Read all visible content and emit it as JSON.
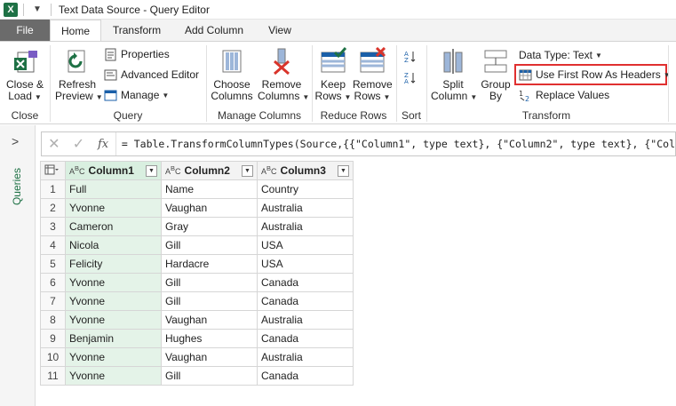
{
  "window": {
    "title": "Text Data Source - Query Editor",
    "app_logo": "X"
  },
  "tabs": [
    "File",
    "Home",
    "Transform",
    "Add Column",
    "View"
  ],
  "ribbon": {
    "close": {
      "btn": "Close &",
      "btn2": "Load",
      "group": "Close"
    },
    "query": {
      "refresh": "Refresh",
      "refresh2": "Preview",
      "properties": "Properties",
      "advanced_editor": "Advanced Editor",
      "manage": "Manage",
      "group": "Query"
    },
    "manage_columns": {
      "choose": "Choose",
      "choose2": "Columns",
      "remove": "Remove",
      "remove2": "Columns",
      "group": "Manage Columns"
    },
    "reduce_rows": {
      "keep": "Keep",
      "keep2": "Rows",
      "remove": "Remove",
      "remove2": "Rows",
      "group": "Reduce Rows"
    },
    "sort": {
      "group": "Sort"
    },
    "transform": {
      "split": "Split",
      "split2": "Column",
      "group_by": "Group",
      "group_by2": "By",
      "data_type": "Data Type: Text",
      "first_row": "Use First Row As Headers",
      "replace": "Replace Values",
      "group": "Transform"
    }
  },
  "side": {
    "label": "Queries"
  },
  "formula": {
    "text": "= Table.TransformColumnTypes(Source,{{\"Column1\", type text}, {\"Column2\", type text}, {\"Col"
  },
  "table": {
    "headers": [
      "Column1",
      "Column2",
      "Column3"
    ],
    "rows": [
      [
        "1",
        "Full",
        "Name",
        "Country"
      ],
      [
        "2",
        "Yvonne",
        "Vaughan",
        "Australia"
      ],
      [
        "3",
        "Cameron",
        "Gray",
        "Australia"
      ],
      [
        "4",
        "Nicola",
        "Gill",
        "USA"
      ],
      [
        "5",
        "Felicity",
        "Hardacre",
        "USA"
      ],
      [
        "6",
        "Yvonne",
        "Gill",
        "Canada"
      ],
      [
        "7",
        "Yvonne",
        "Gill",
        "Canada"
      ],
      [
        "8",
        "Yvonne",
        "Vaughan",
        "Australia"
      ],
      [
        "9",
        "Benjamin",
        "Hughes",
        "Canada"
      ],
      [
        "10",
        "Yvonne",
        "Vaughan",
        "Australia"
      ],
      [
        "11",
        "Yvonne",
        "Gill",
        "Canada"
      ]
    ]
  }
}
